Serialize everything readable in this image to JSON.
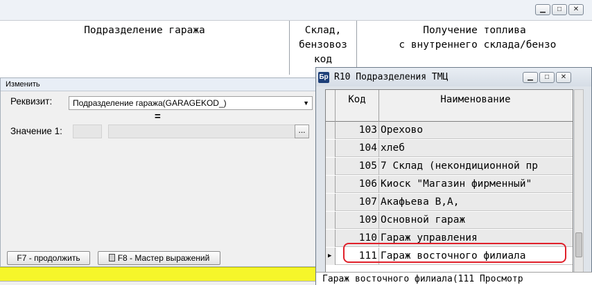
{
  "background_window": {
    "controls": [
      "▁",
      "□",
      "✕"
    ],
    "columns": [
      {
        "label": "Подразделение гаража"
      },
      {
        "label": "Склад,\nбензовоз\nкод"
      },
      {
        "label": "Получение топлива\n с внутреннего склада/бензо"
      }
    ]
  },
  "filter_dialog": {
    "title": "Изменить",
    "attribute_label": "Реквизит:",
    "attribute_value": "Подразделение гаража(GARAGEKOD_)",
    "operator": "=",
    "value_label": "Значение 1:",
    "browse_button": "...",
    "continue_button": "F7 - продолжить",
    "expression_button": "F8 - Мастер выражений"
  },
  "lookup_window": {
    "app_icon": "Бр",
    "title": "R10 Подразделения ТМЦ",
    "controls": [
      "▁",
      "□",
      "✕"
    ],
    "columns": {
      "code": "Код",
      "name": "Наименование"
    },
    "rows": [
      {
        "code": "103",
        "name": "Орехово"
      },
      {
        "code": "104",
        "name": "хлеб"
      },
      {
        "code": "105",
        "name": "7 Склад (некондиционной пр"
      },
      {
        "code": "106",
        "name": "Киоск \"Магазин фирменный\""
      },
      {
        "code": "107",
        "name": "Акафьева В,А,"
      },
      {
        "code": "109",
        "name": "Основной гараж"
      },
      {
        "code": "110",
        "name": "Гараж управления"
      },
      {
        "code": "111",
        "name": "Гараж восточного филиала"
      }
    ],
    "selected_row_marker": "▶",
    "status_text": "Гараж восточного филиала(111 Просмотр"
  },
  "colors": {
    "highlight_ring": "#e0202a",
    "yellow_strip": "#f6f62a"
  }
}
